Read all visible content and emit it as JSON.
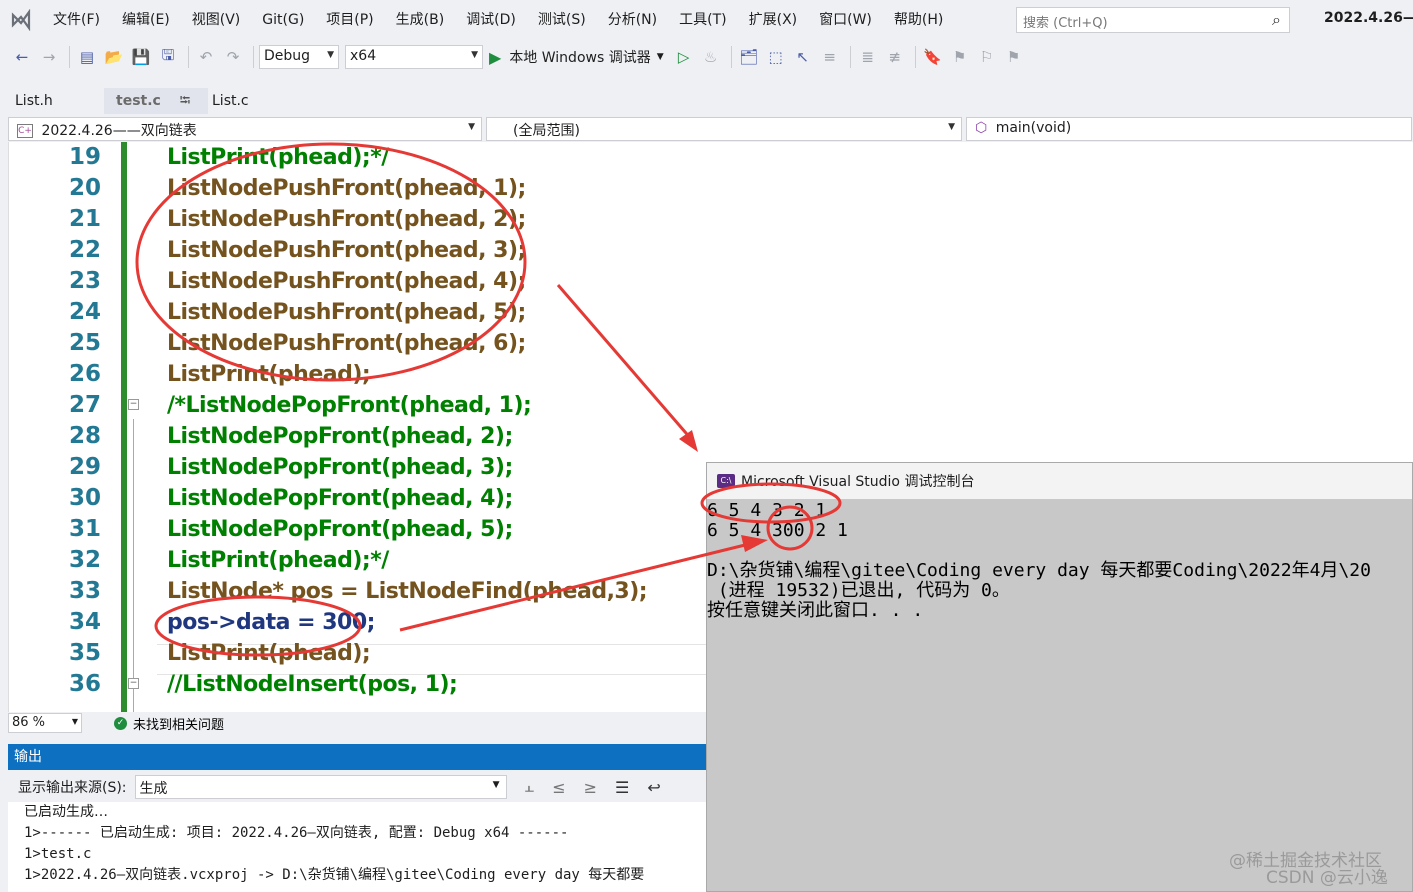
{
  "menubar": {
    "items": [
      "文件(F)",
      "编辑(E)",
      "视图(V)",
      "Git(G)",
      "项目(P)",
      "生成(B)",
      "调试(D)",
      "测试(S)",
      "分析(N)",
      "工具(T)",
      "扩展(X)",
      "窗口(W)",
      "帮助(H)"
    ],
    "search_placeholder": "搜索 (Ctrl+Q)",
    "window_title": "2022.4.26—"
  },
  "toolbar": {
    "config": "Debug",
    "platform": "x64",
    "run_label": "本地 Windows 调试器"
  },
  "tabs": [
    {
      "label": "List.h"
    },
    {
      "label": "test.c"
    },
    {
      "label": "List.c"
    }
  ],
  "navbar": {
    "project": "2022.4.26——双向链表",
    "scope": "(全局范围)",
    "member": "main(void)"
  },
  "code": {
    "lines": [
      {
        "num": "19",
        "text": "ListPrint(phead);*/"
      },
      {
        "num": "20",
        "text": "ListNodePushFront(phead, 1);"
      },
      {
        "num": "21",
        "text": "ListNodePushFront(phead, 2);"
      },
      {
        "num": "22",
        "text": "ListNodePushFront(phead, 3);"
      },
      {
        "num": "23",
        "text": "ListNodePushFront(phead, 4);"
      },
      {
        "num": "24",
        "text": "ListNodePushFront(phead, 5);"
      },
      {
        "num": "25",
        "text": "ListNodePushFront(phead, 6);"
      },
      {
        "num": "26",
        "text": "ListPrint(phead);"
      },
      {
        "num": "27",
        "text": "/*ListNodePopFront(phead, 1);"
      },
      {
        "num": "28",
        "text": "ListNodePopFront(phead, 2);"
      },
      {
        "num": "29",
        "text": "ListNodePopFront(phead, 3);"
      },
      {
        "num": "30",
        "text": "ListNodePopFront(phead, 4);"
      },
      {
        "num": "31",
        "text": "ListNodePopFront(phead, 5);"
      },
      {
        "num": "32",
        "text": "ListPrint(phead);*/"
      },
      {
        "num": "33",
        "text": "ListNode* pos = ListNodeFind(phead,3);"
      },
      {
        "num": "34",
        "text": "pos->data = 300;"
      },
      {
        "num": "35",
        "text": "ListPrint(phead);"
      },
      {
        "num": "36",
        "text": "//ListNodeInsert(pos, 1);"
      }
    ]
  },
  "status": {
    "zoom": "86 %",
    "issues": "未找到相关问题"
  },
  "output": {
    "title": "输出",
    "source_label": "显示输出来源(S):",
    "source_value": "生成",
    "lines": [
      "已启动生成…",
      "1>------ 已启动生成: 项目: 2022.4.26—双向链表, 配置: Debug x64 ------",
      "1>test.c",
      "1>2022.4.26—双向链表.vcxproj -> D:\\杂货铺\\编程\\gitee\\Coding every day 每天都要"
    ]
  },
  "console": {
    "title": "Microsoft Visual Studio 调试控制台",
    "lines": [
      "6 5 4 3 2 1",
      "6 5 4 300 2 1",
      "",
      "D:\\杂货铺\\编程\\gitee\\Coding every day 每天都要Coding\\2022年4月\\20",
      " (进程 19532)已退出, 代码为 0。",
      "按任意键关闭此窗口. . ."
    ]
  },
  "watermark": {
    "line1": "@稀土掘金技术社区",
    "line2": "CSDN @云小逸"
  },
  "colors": {
    "annotation": "#e53935",
    "output_header": "#0e70c0"
  }
}
